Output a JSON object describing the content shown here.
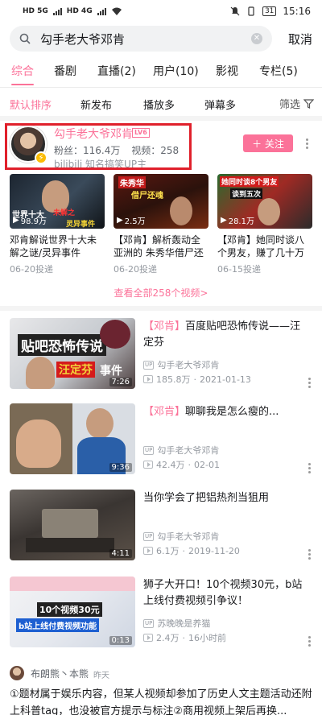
{
  "status_bar": {
    "left_a": "HD 5G",
    "left_b": "HD 4G",
    "battery": "31",
    "time": "15:16"
  },
  "search": {
    "query": "勾手老大爷邓肯",
    "cancel": "取消"
  },
  "tabs": [
    "综合",
    "番剧",
    "直播(2)",
    "用户(10)",
    "影视",
    "专栏(5)"
  ],
  "sort": {
    "options": [
      "默认排序",
      "新发布",
      "播放多",
      "弹幕多"
    ],
    "filter": "筛选"
  },
  "user": {
    "name": "勾手老大爷邓肯",
    "level": "LV6",
    "fans": "粉丝：116.4万",
    "videos": "视频：258",
    "cert": "bilibili 知名搞笑UP主",
    "follow": "＋ 关注"
  },
  "mini_videos": [
    {
      "title": "邓肯解说世界十大未解之谜/灵异事件",
      "plays": "98.9万",
      "date": "06-20投递",
      "overlay1": "世界十大",
      "overlay2": "未解之",
      "overlay3": "灵异事件"
    },
    {
      "title": "【邓肯】解析轰动全亚洲的 朱秀华借尸还魂...",
      "plays": "2.5万",
      "date": "06-20投递",
      "overlay1": "朱秀华",
      "overlay2": "借尸还魂"
    },
    {
      "title": "【邓肯】她同时谈八个男友，赚了几十万你...",
      "plays": "28.1万",
      "date": "06-15投递",
      "overlay1": "她同时谈8个男友",
      "overlay2": "谈到五次"
    }
  ],
  "see_all": "查看全部258个视频>",
  "videos": [
    {
      "kw": "【邓肯】",
      "rest": "百度贴吧恐怖传说——汪定芬",
      "up": "勾手老大爷邓肯",
      "plays": "185.8万",
      "date": "2021-01-13",
      "dur": "7:26",
      "overlay1": "贴吧恐怖传说",
      "overlay2": "汪定芬",
      "overlay3": "事件"
    },
    {
      "kw": "【邓肯】",
      "rest": "聊聊我是怎么瘦的...",
      "up": "勾手老大爷邓肯",
      "plays": "42.4万",
      "date": "02-01",
      "dur": "9:36"
    },
    {
      "kw": "",
      "rest": "当你学会了把铝热剂当狙用",
      "up": "勾手老大爷邓肯",
      "plays": "6.1万",
      "date": "2019-11-20",
      "dur": "4:11"
    },
    {
      "kw": "",
      "rest": "狮子大开口！10个视频30元，b站上线付费视频引争议！",
      "up": "苏晚晚是养猫",
      "plays": "2.4万",
      "date": "16小时前",
      "dur": "0:13",
      "overlay1": "10个视频30元",
      "overlay2": "b站上线付费视频功能"
    }
  ],
  "comment": {
    "name": "布朗熊丶本熊",
    "time": "昨天",
    "text": "①题材属于娱乐内容，但某人视频却参加了历史人文主题活动还附上科普tag，也没被官方提示与标注②商用视频上架后再换..."
  }
}
